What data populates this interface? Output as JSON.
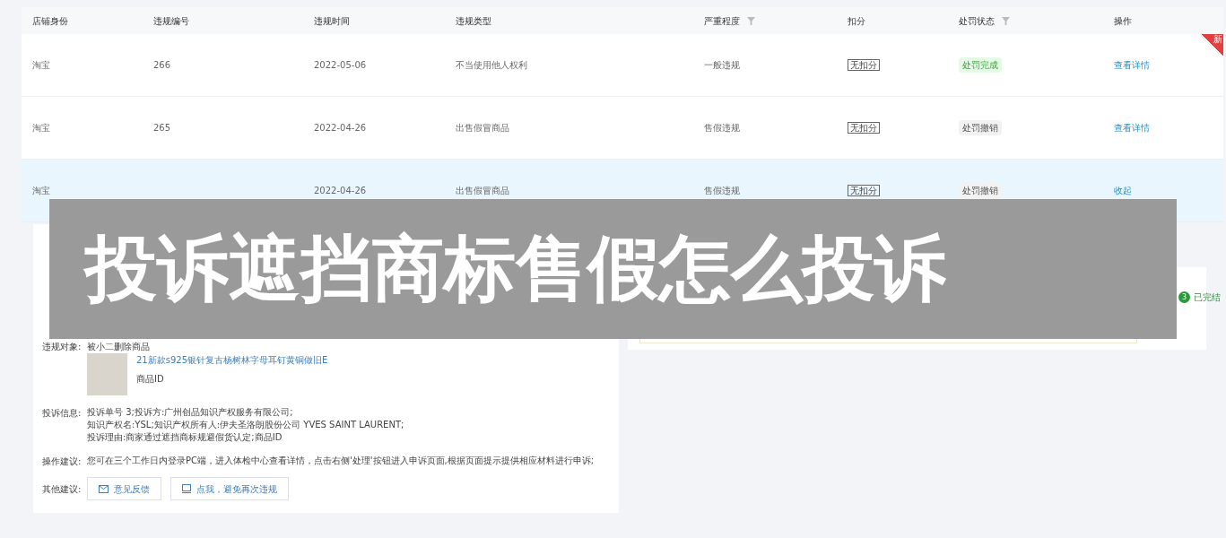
{
  "table": {
    "columns": [
      {
        "label": "店铺身份",
        "filter": false
      },
      {
        "label": "违规编号",
        "filter": false
      },
      {
        "label": "违规时间",
        "filter": false
      },
      {
        "label": "违规类型",
        "filter": false
      },
      {
        "label": "严重程度",
        "filter": true
      },
      {
        "label": "扣分",
        "filter": false
      },
      {
        "label": "处罚状态",
        "filter": true
      },
      {
        "label": "操作",
        "filter": false
      }
    ],
    "rows": [
      {
        "shop": "淘宝",
        "id": "266",
        "time": "2022-05-06",
        "type": "不当使用他人权利",
        "severity": "一般违规",
        "points": "无扣分",
        "status": {
          "label": "处罚完成",
          "kind": "success"
        },
        "action": "查看详情",
        "selected": false,
        "badge": "新"
      },
      {
        "shop": "淘宝",
        "id": "265",
        "time": "2022-04-26",
        "type": "出售假冒商品",
        "severity": "售假违规",
        "points": "无扣分",
        "status": {
          "label": "处罚撤销",
          "kind": "neutral"
        },
        "action": "查看详情",
        "selected": false
      },
      {
        "shop": "淘宝",
        "time": "2022-04-26",
        "type": "出售假冒商品",
        "severity": "售假违规",
        "points": "无扣分",
        "status": {
          "label": "处罚撤销",
          "kind": "neutral"
        },
        "action": "收起",
        "selected": true
      }
    ]
  },
  "detail": {
    "fields": [
      {
        "label": "违规对象:",
        "value": "被小二删除商品"
      }
    ],
    "product": {
      "title": "21新款s925银针复古杨树林字母耳钉黄铜做旧E",
      "id_label": "商品ID"
    },
    "complaint": {
      "label": "投诉信息:",
      "lines": [
        "投诉单号 3;投诉方:广州创品知识产权服务有限公司;",
        "知识产权名:YSL;知识产权所有人:伊夫圣洛朗股份公司 YVES SAINT LAURENT;",
        "投诉理由:商家通过遮挡商标规避假货认定;商品ID"
      ]
    },
    "advice": {
      "label": "操作建议:",
      "text": "您可在三个工作日内登录PC端，进入体检中心查看详情，点击右侧'处理'按钮进入申诉页面,根据页面提示提供相应材料进行申诉;"
    },
    "other": {
      "label": "其他建议:",
      "buttons": [
        "意见反馈",
        "点我，避免再次违规"
      ]
    }
  },
  "appeal": {
    "step": {
      "number": "3",
      "label": "已完结"
    }
  },
  "banner": {
    "title": "投诉遮挡商标售假怎么投诉"
  }
}
